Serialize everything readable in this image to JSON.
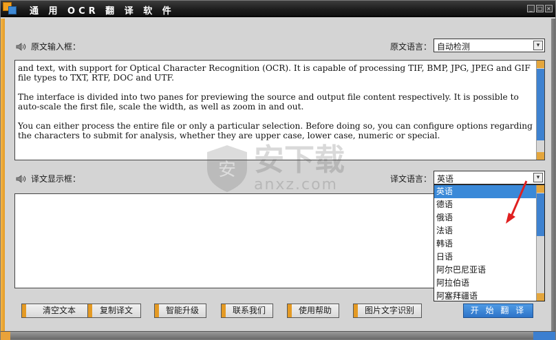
{
  "window": {
    "title": "通 用 OCR 翻 译 软 件",
    "buttons": [
      "_",
      "□",
      "×"
    ]
  },
  "source": {
    "section_label": "原文输入框：",
    "lang_label": "原文语言：",
    "lang_value": "自动检测",
    "paragraphs": [
      "and text, with support for Optical Character Recognition (OCR). It is capable of processing TIF, BMP, JPG, JPEG and GIF file types to TXT, RTF, DOC and UTF.",
      "The interface is divided into two panes for previewing the source and output file content respectively. It is possible to auto-scale the first file, scale the width, as well as zoom in and out.",
      "You can either process the entire file or only a particular selection. Before doing so, you can configure options regarding the characters to submit for analysis, whether they are upper case, lower case, numeric or special."
    ]
  },
  "target": {
    "section_label": "译文显示框：",
    "lang_label": "译文语言：",
    "lang_value": "英语",
    "options": [
      "英语",
      "德语",
      "俄语",
      "法语",
      "韩语",
      "日语",
      "阿尔巴尼亚语",
      "阿拉伯语",
      "阿塞拜疆语"
    ],
    "selected_index": 0
  },
  "actions": {
    "clear": "清空文本",
    "copy": "复制译文",
    "upgrade": "智能升级",
    "contact": "联系我们",
    "help": "使用帮助",
    "image_ocr": "图片文字识别",
    "translate": "开 始 翻 译"
  },
  "watermark": {
    "text": "安下载",
    "sub": "anxz.com"
  },
  "colors": {
    "accent_orange": "#e49a24",
    "accent_blue": "#3a89d8",
    "arrow_red": "#e02020"
  },
  "icons": {
    "speaker": "speaker-icon",
    "dropdown": "dropdown-arrow-icon"
  }
}
